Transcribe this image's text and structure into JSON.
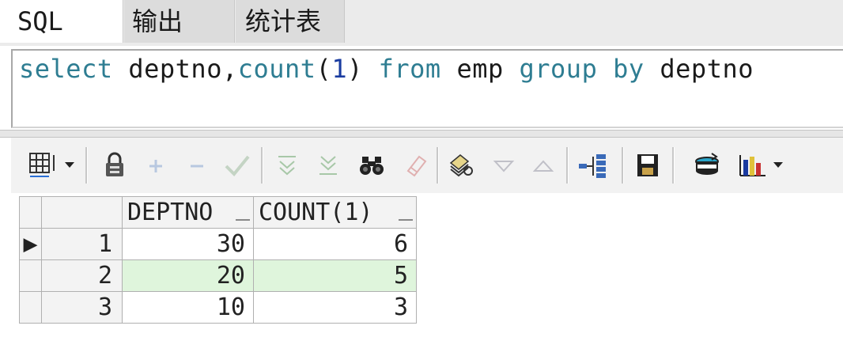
{
  "tabs": [
    {
      "label": "SQL",
      "active": true
    },
    {
      "label": "输出",
      "active": false
    },
    {
      "label": "统计表",
      "active": false
    }
  ],
  "editor": {
    "tokens": [
      {
        "t": "select",
        "k": "kw"
      },
      {
        "t": " deptno,",
        "k": "tx"
      },
      {
        "t": "count",
        "k": "kw"
      },
      {
        "t": "(",
        "k": "tx"
      },
      {
        "t": "1",
        "k": "nm"
      },
      {
        "t": ") ",
        "k": "tx"
      },
      {
        "t": "from",
        "k": "kw"
      },
      {
        "t": " emp ",
        "k": "tx"
      },
      {
        "t": "group",
        "k": "kw"
      },
      {
        "t": " ",
        "k": "tx"
      },
      {
        "t": "by",
        "k": "kw"
      },
      {
        "t": " deptno",
        "k": "tx"
      }
    ]
  },
  "toolbar": {
    "icons": [
      "grid-menu-icon",
      "lock-icon",
      "add-row-icon",
      "delete-row-icon",
      "post-icon",
      "fetch-next-icon",
      "fetch-last-icon",
      "find-icon",
      "clear-icon",
      "query-by-example-icon",
      "previous-record-icon",
      "next-record-icon",
      "tree-icon",
      "save-icon",
      "export-icon",
      "chart-icon"
    ]
  },
  "grid": {
    "columns": [
      "DEPTNO",
      "COUNT(1)"
    ],
    "rows": [
      {
        "num": "1",
        "deptno": "30",
        "count": "6"
      },
      {
        "num": "2",
        "deptno": "20",
        "count": "5"
      },
      {
        "num": "3",
        "deptno": "10",
        "count": "3"
      }
    ],
    "current_row_marker": "▶"
  }
}
